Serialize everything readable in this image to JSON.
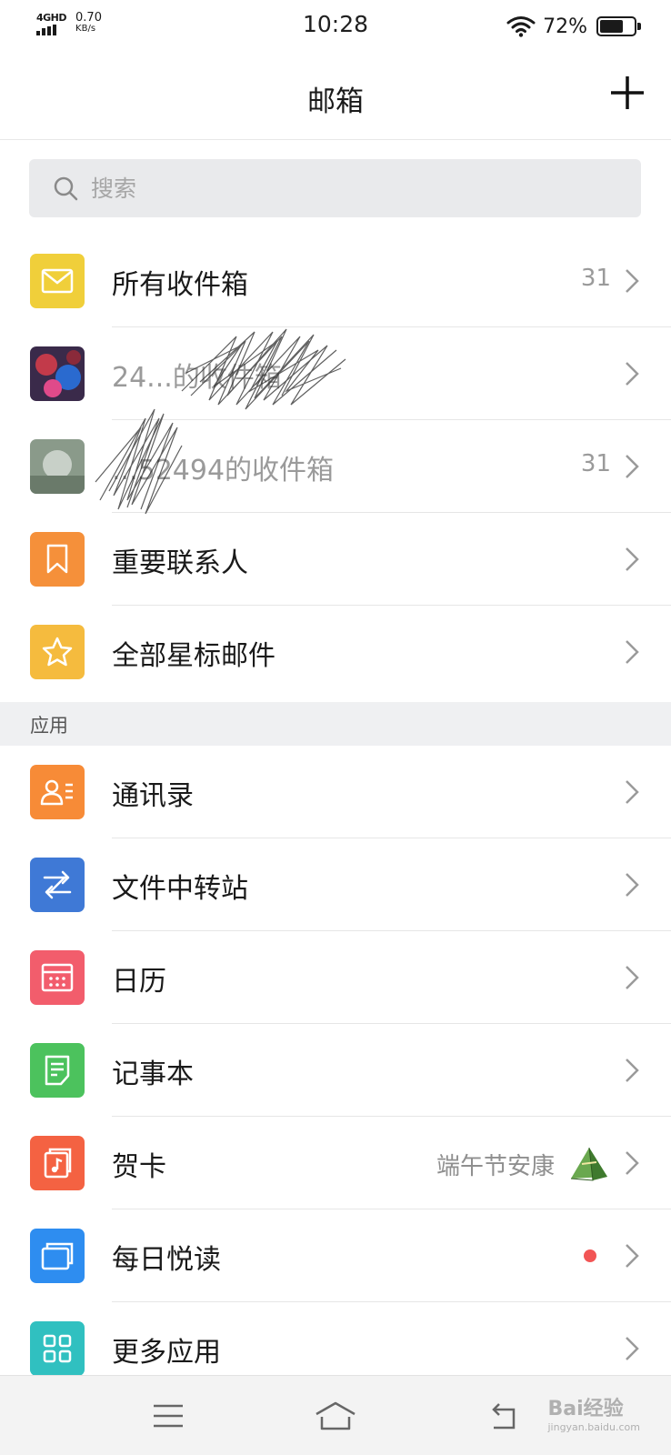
{
  "status_bar": {
    "network": "4GHD",
    "speed_value": "0.70",
    "speed_unit": "KB/s",
    "time": "10:28",
    "battery_percent": "72%",
    "battery_level": 0.72
  },
  "header": {
    "title": "邮箱",
    "add_icon": "plus-icon"
  },
  "search": {
    "placeholder": "搜索",
    "icon": "search-icon"
  },
  "mailboxes": [
    {
      "label": "所有收件箱",
      "count": "31",
      "icon": "envelope-icon",
      "color": "#f0cf3a"
    },
    {
      "label": "24...的收件箱",
      "count": "",
      "icon": "avatar-image"
    },
    {
      "label": "...52494的收件箱",
      "count": "31",
      "icon": "avatar-image"
    },
    {
      "label": "重要联系人",
      "count": "",
      "icon": "bookmark-icon",
      "color": "#f5903a"
    },
    {
      "label": "全部星标邮件",
      "count": "",
      "icon": "star-icon",
      "color": "#f5bb3e"
    }
  ],
  "apps_section": {
    "title": "应用"
  },
  "apps": [
    {
      "label": "通讯录",
      "icon": "contacts-icon",
      "color": "#f78b37"
    },
    {
      "label": "文件中转站",
      "icon": "transfer-icon",
      "color": "#3f79d6"
    },
    {
      "label": "日历",
      "icon": "calendar-icon",
      "color": "#f25d6c"
    },
    {
      "label": "记事本",
      "icon": "notepad-icon",
      "color": "#4cc25d"
    },
    {
      "label": "贺卡",
      "icon": "card-icon",
      "color": "#f46242",
      "extra": "端午节安康",
      "extra_icon": "zongzi-icon"
    },
    {
      "label": "每日悦读",
      "icon": "reading-icon",
      "color": "#2e8df0",
      "badge": "red-dot"
    },
    {
      "label": "更多应用",
      "icon": "grid-icon",
      "color": "#30c0c0"
    }
  ],
  "bottom_nav": {
    "menu_icon": "menu-icon",
    "home_icon": "home-icon",
    "back_icon": "back-icon"
  },
  "watermark": {
    "text": "Bai经验",
    "sub": "jingyan.baidu.com"
  }
}
